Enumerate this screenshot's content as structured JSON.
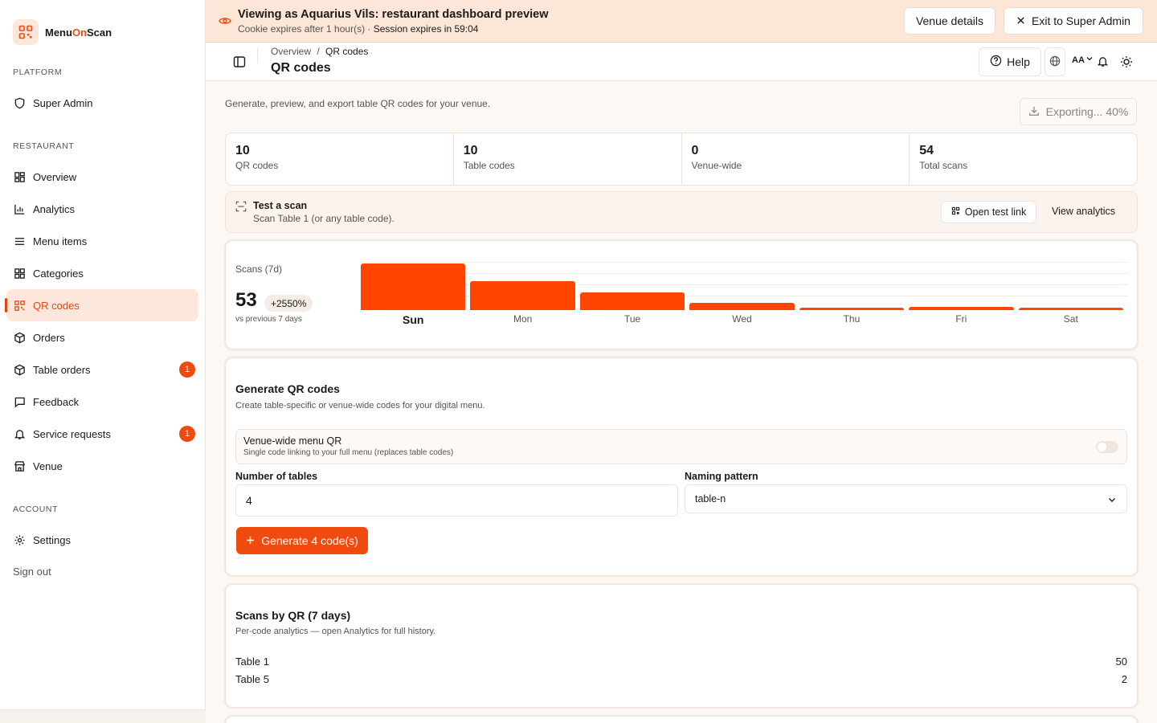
{
  "brand": {
    "name_prefix": "Menu",
    "name_on": "On",
    "name_suffix": "Scan"
  },
  "sidebar": {
    "sections": {
      "platform": "PLATFORM",
      "restaurant": "RESTAURANT",
      "account": "ACCOUNT"
    },
    "items": [
      {
        "label": "Super Admin",
        "icon": "shield-icon"
      },
      {
        "label": "Overview",
        "icon": "grid-icon"
      },
      {
        "label": "Analytics",
        "icon": "bar-chart-icon"
      },
      {
        "label": "Menu items",
        "icon": "list-icon"
      },
      {
        "label": "Categories",
        "icon": "grid-icon"
      },
      {
        "label": "QR codes",
        "icon": "qr-icon",
        "active": true
      },
      {
        "label": "Orders",
        "icon": "box-icon"
      },
      {
        "label": "Table orders",
        "icon": "box-icon",
        "badge": "1"
      },
      {
        "label": "Feedback",
        "icon": "message-icon"
      },
      {
        "label": "Service requests",
        "icon": "bell-icon",
        "badge": "1"
      },
      {
        "label": "Venue",
        "icon": "store-icon"
      },
      {
        "label": "Settings",
        "icon": "gear-icon"
      }
    ],
    "signout": "Sign out"
  },
  "banner": {
    "title": "Viewing as Aquarius Vils: restaurant dashboard preview",
    "sub_cookie": "Cookie expires after 1 hour(s) · ",
    "sub_session": "Session expires in 59:04",
    "venue_details": "Venue details",
    "exit": "Exit to Super Admin"
  },
  "topbar": {
    "crumb_parent": "Overview",
    "crumb_sep": "/",
    "crumb_current": "QR codes",
    "title": "QR codes",
    "help": "Help",
    "font_size_label": "AA"
  },
  "main": {
    "description": "Generate, preview, and export table QR codes for your venue.",
    "export_label": "Exporting... 40%",
    "stats": [
      {
        "value": "10",
        "label": "QR codes"
      },
      {
        "value": "10",
        "label": "Table codes"
      },
      {
        "value": "0",
        "label": "Venue-wide"
      },
      {
        "value": "54",
        "label": "Total scans"
      }
    ],
    "test_scan": {
      "title": "Test a scan",
      "sub": "Scan Table 1 (or any table code).",
      "open_link": "Open test link",
      "view_analytics": "View analytics"
    }
  },
  "scans_card": {
    "label": "Scans (7d)",
    "total": "53",
    "change": "+2550%",
    "compare": "vs previous 7 days"
  },
  "chart_data": {
    "type": "bar",
    "categories": [
      "Sun",
      "Mon",
      "Tue",
      "Wed",
      "Thu",
      "Fri",
      "Sat"
    ],
    "values": [
      40,
      25,
      15,
      6,
      2,
      3,
      2
    ],
    "highlight": "Sun",
    "color": "#ff4500"
  },
  "generate": {
    "title": "Generate QR codes",
    "sub": "Create table-specific or venue-wide codes for your digital menu.",
    "venue_wide_title": "Venue-wide menu QR",
    "venue_wide_sub": "Single code linking to your full menu (replaces table codes)",
    "tables_label": "Number of tables",
    "tables_value": "4",
    "pattern_label": "Naming pattern",
    "pattern_value": "table-n",
    "button": "Generate 4 code(s)"
  },
  "scans_by_qr": {
    "title": "Scans by QR (7 days)",
    "sub": "Per-code analytics — open Analytics for full history.",
    "rows": [
      {
        "name": "Table 1",
        "count": "50"
      },
      {
        "name": "Table 5",
        "count": "2"
      }
    ]
  },
  "colors": {
    "accent": "#f04a0f",
    "accent_soft": "#fde7dc",
    "banner": "#fbe6d8"
  }
}
